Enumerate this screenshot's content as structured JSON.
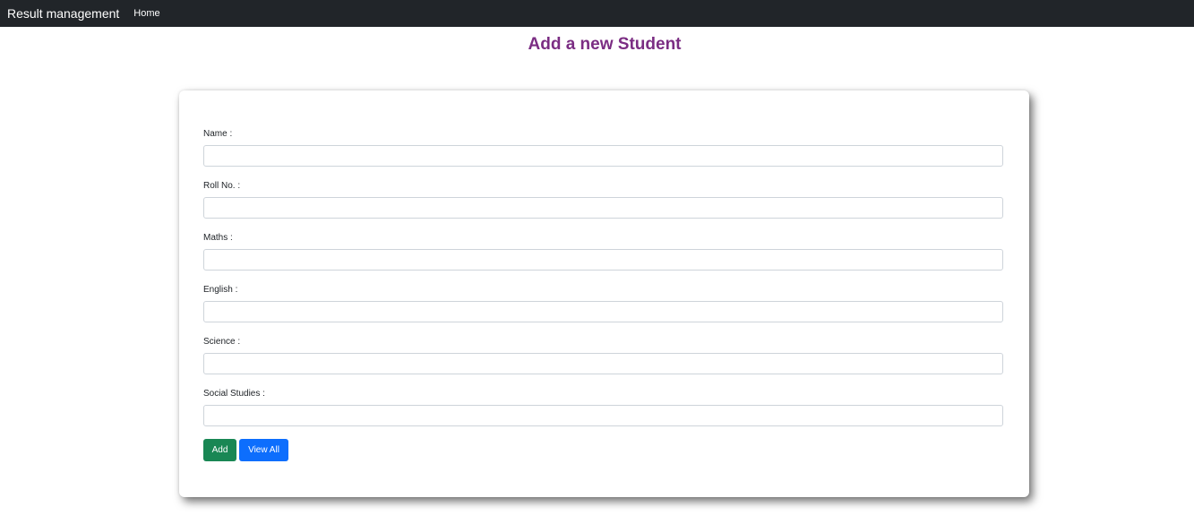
{
  "navbar": {
    "brand": "Result management",
    "links": [
      {
        "label": "Home"
      }
    ]
  },
  "page": {
    "title": "Add a new Student"
  },
  "form": {
    "fields": [
      {
        "label": "Name :",
        "value": ""
      },
      {
        "label": "Roll No. :",
        "value": ""
      },
      {
        "label": "Maths :",
        "value": ""
      },
      {
        "label": "English :",
        "value": ""
      },
      {
        "label": "Science :",
        "value": ""
      },
      {
        "label": "Social Studies :",
        "value": ""
      }
    ],
    "add_label": "Add",
    "view_all_label": "View All"
  },
  "colors": {
    "navbar_bg": "#212529",
    "title": "#7b2d83",
    "add_button": "#198754",
    "view_all_button": "#0d6efd"
  }
}
